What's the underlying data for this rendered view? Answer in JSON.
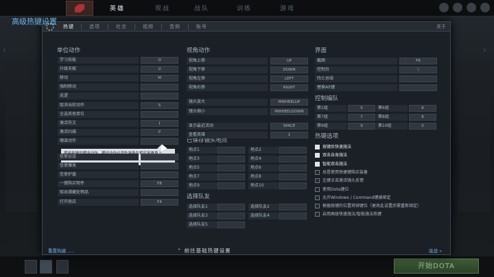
{
  "topnav": {
    "items": [
      "英雄",
      "观战",
      "战队",
      "训练",
      "游戏"
    ]
  },
  "bottom": {
    "play_label": "开始DOTA"
  },
  "dialog": {
    "tabs": [
      "热键",
      "选项",
      "社交",
      "视频",
      "音频",
      "账号"
    ],
    "close_label": "关于",
    "title": "高级热键设置",
    "unit_actions": {
      "heading": "单位动作",
      "rows": [
        {
          "label": "学习技能",
          "key": "O"
        },
        {
          "label": "升级天赋",
          "key": "U"
        },
        {
          "label": "移动",
          "key": "M"
        },
        {
          "label": "强制移动",
          "key": ""
        },
        {
          "label": "巡逻",
          "key": ""
        },
        {
          "label": "取消当前动作",
          "key": "S"
        },
        {
          "label": "全选其他单位",
          "key": ""
        },
        {
          "label": "激活符文",
          "key": "J"
        },
        {
          "label": "激活扫描",
          "key": "P"
        },
        {
          "label": "嘲讽动作",
          "key": ""
        },
        {
          "label": "信使运送",
          "key": ""
        },
        {
          "label": "信使爆发",
          "key": ""
        },
        {
          "label": "信使护盾",
          "key": ""
        },
        {
          "label": "一键购买物件",
          "key": "F8"
        },
        {
          "label": "取出储藏处物品",
          "key": ""
        },
        {
          "label": "打开商店",
          "key": "F4"
        }
      ]
    },
    "tooltip": "使用英雄的嘲讽动作。嘲讽动作必须先装备在相应英雄身上。",
    "camera": {
      "heading": "视角动作",
      "rows": [
        {
          "label": "视角上移",
          "key": "UP"
        },
        {
          "label": "视角下移",
          "key": "DOWN"
        },
        {
          "label": "视角左移",
          "key": "LEFT"
        },
        {
          "label": "视角右移",
          "key": "RIGHT"
        },
        {
          "label": "镜头放大",
          "key": "MWHEELUP"
        },
        {
          "label": "镜头缩小",
          "key": "MWHEELDOWN"
        },
        {
          "label": "显示最近活动",
          "key": "SPACE"
        },
        {
          "label": "查看英雄",
          "key": "1"
        }
      ]
    },
    "saved_camera": {
      "heading": "已保存镜头地点",
      "items": [
        "地点1",
        "地点2",
        "地点3",
        "地点4",
        "地点5",
        "地点6",
        "地点7",
        "地点8",
        "地点9",
        "地点10"
      ]
    },
    "select_ally": {
      "heading": "选择队友",
      "items": [
        "选择队友1",
        "选择队友2",
        "选择队友3",
        "选择队友4",
        "选择队友5"
      ]
    },
    "interface": {
      "heading": "界面",
      "rows": [
        {
          "label": "截图",
          "key": "F6"
        },
        {
          "label": "控制台",
          "key": "\\"
        },
        {
          "label": "阵亡总结",
          "key": ""
        },
        {
          "label": "替换Alt键",
          "key": ""
        }
      ]
    },
    "control_groups": {
      "heading": "控制编队",
      "items": [
        {
          "label": "第1组",
          "key": "5"
        },
        {
          "label": "第6组",
          "key": "6"
        },
        {
          "label": "第7组",
          "key": "7"
        },
        {
          "label": "第8组",
          "key": "8"
        },
        {
          "label": "第9组",
          "key": "9"
        },
        {
          "label": "第10组",
          "key": "0"
        }
      ]
    },
    "hotkey_options": {
      "heading": "热键选项",
      "items": [
        {
          "label": "按键后快速施法",
          "checked": true
        },
        {
          "label": "双击自身施法",
          "checked": true
        },
        {
          "label": "智能双击施法",
          "checked": true
        },
        {
          "label": "总是使用快捷键购买装备",
          "checked": false
        },
        {
          "label": "左键点击激活镜头反馈",
          "checked": false
        },
        {
          "label": "使用Dota键位",
          "checked": false
        },
        {
          "label": "允许Windows / Command键被绑定",
          "checked": false
        },
        {
          "label": "根据按键的位置将绑键位（更改此设置后需重新绑定）",
          "checked": false
        },
        {
          "label": "启用高级快速施法/智能施法热键",
          "checked": false
        }
      ]
    },
    "footer": {
      "reset_label": "重置热键……",
      "basic_label": "前往基础热键设置",
      "legacy_label": "底战 »"
    }
  }
}
